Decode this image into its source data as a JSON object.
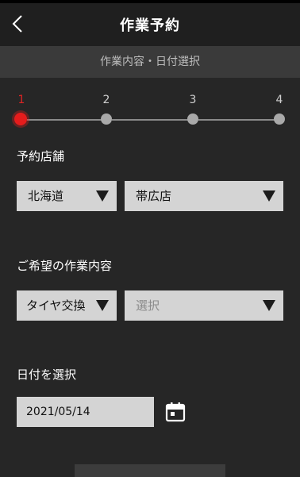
{
  "header": {
    "title": "作業予約",
    "back_icon": "chevron-left-icon"
  },
  "subheader": {
    "text": "作業内容・日付選択"
  },
  "stepper": {
    "active_color": "#e51c1c",
    "steps": [
      {
        "label": "1",
        "active": true
      },
      {
        "label": "2",
        "active": false
      },
      {
        "label": "3",
        "active": false
      },
      {
        "label": "4",
        "active": false
      }
    ]
  },
  "store": {
    "label": "予約店舗",
    "prefecture": {
      "value": "北海道"
    },
    "branch": {
      "value": "帯広店"
    }
  },
  "work": {
    "label": "ご希望の作業内容",
    "category": {
      "value": "タイヤ交換"
    },
    "detail": {
      "placeholder": "選択"
    }
  },
  "date": {
    "label": "日付を選択",
    "value": "2021/05/14",
    "calendar_icon": "calendar-icon"
  }
}
